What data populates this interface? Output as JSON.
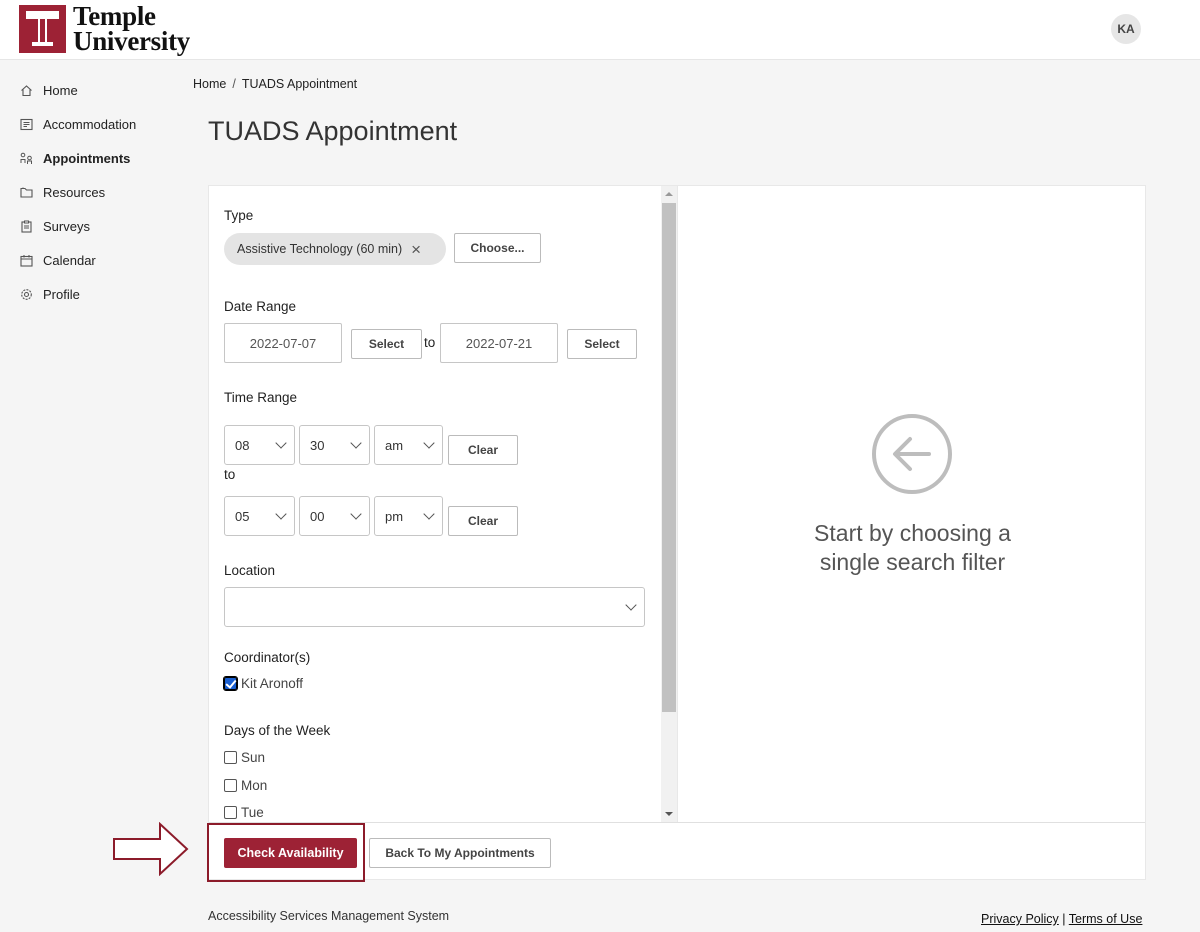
{
  "header": {
    "logo_line1": "Temple",
    "logo_line2": "University",
    "avatar_initials": "KA"
  },
  "sidebar": {
    "items": [
      {
        "label": "Home",
        "icon": "home-icon"
      },
      {
        "label": "Accommodation",
        "icon": "list-icon"
      },
      {
        "label": "Appointments",
        "icon": "appointments-icon",
        "active": true
      },
      {
        "label": "Resources",
        "icon": "folder-icon"
      },
      {
        "label": "Surveys",
        "icon": "clipboard-icon"
      },
      {
        "label": "Calendar",
        "icon": "calendar-icon"
      },
      {
        "label": "Profile",
        "icon": "gear-icon"
      }
    ]
  },
  "breadcrumb": {
    "home": "Home",
    "separator": "/",
    "current": "TUADS Appointment"
  },
  "page_title": "TUADS Appointment",
  "form": {
    "type": {
      "label": "Type",
      "chip": "Assistive Technology (60 min)",
      "chip_remove": "×",
      "choose": "Choose..."
    },
    "date_range": {
      "label": "Date Range",
      "start": "2022-07-07",
      "end": "2022-07-21",
      "select": "Select",
      "to": "to"
    },
    "time_range": {
      "label": "Time Range",
      "start": {
        "hour": "08",
        "minute": "30",
        "ampm": "am"
      },
      "end": {
        "hour": "05",
        "minute": "00",
        "ampm": "pm"
      },
      "to": "to",
      "clear": "Clear"
    },
    "location": {
      "label": "Location",
      "value": ""
    },
    "coordinators": {
      "label": "Coordinator(s)",
      "items": [
        {
          "name": "Kit Aronoff",
          "checked": true
        }
      ]
    },
    "days": {
      "label": "Days of the Week",
      "items": [
        {
          "name": "Sun",
          "checked": false
        },
        {
          "name": "Mon",
          "checked": false
        },
        {
          "name": "Tue",
          "checked": false
        }
      ]
    }
  },
  "empty_state": {
    "line1": "Start by choosing a",
    "line2": "single search filter"
  },
  "actions": {
    "check": "Check Availability",
    "back": "Back To My Appointments"
  },
  "footer": {
    "system": "Accessibility Services Management System",
    "privacy": "Privacy Policy",
    "sep": "|",
    "terms": "Terms of Use"
  },
  "colors": {
    "brand": "#9d2235",
    "checkbox": "#1a5fd0"
  }
}
